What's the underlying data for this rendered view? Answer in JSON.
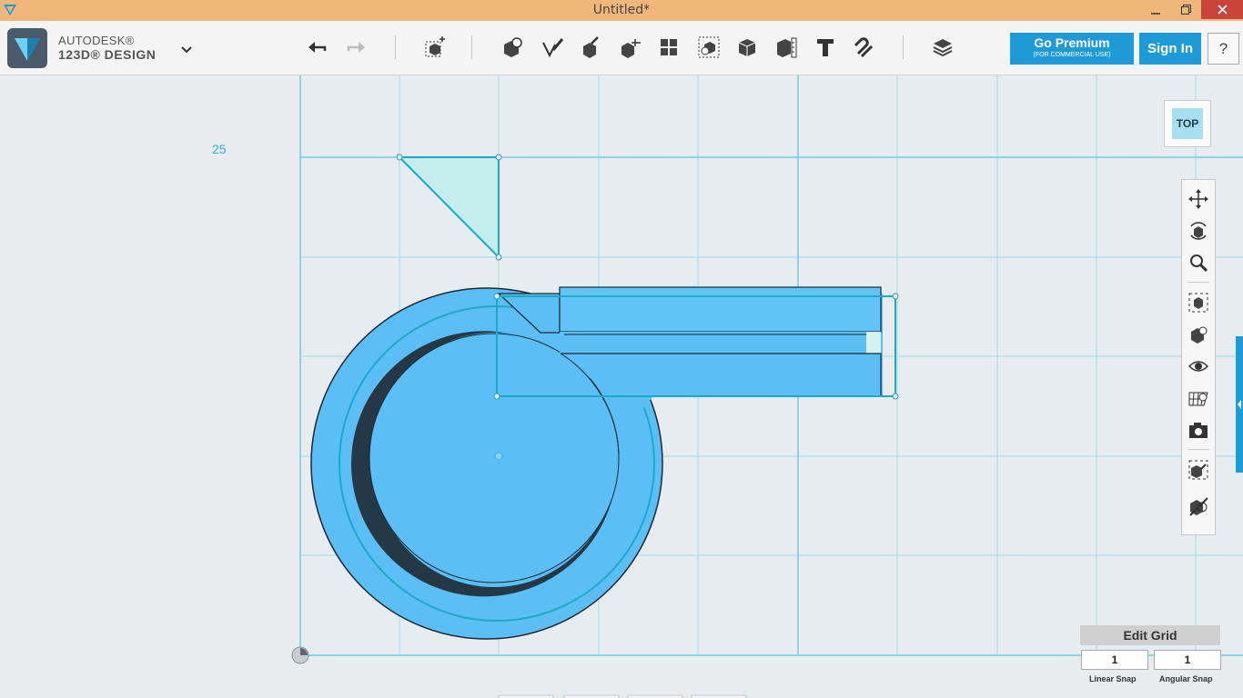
{
  "window": {
    "title": "Untitled*"
  },
  "brand": {
    "line1": "AUTODESK®",
    "line2": "123D® DESIGN"
  },
  "toolbar": {
    "tools": [
      "undo",
      "redo",
      "primitives",
      "sketch",
      "construct",
      "modify",
      "pattern",
      "grouping",
      "combine",
      "measure",
      "text",
      "snap",
      "materials"
    ]
  },
  "account": {
    "premium_title": "Go Premium",
    "premium_sub": "(FOR COMMERCIAL USE)",
    "signin_label": "Sign In",
    "help_label": "?"
  },
  "viewport": {
    "coordinate_label": "25",
    "view_cube_label": "TOP"
  },
  "navigation": {
    "items": [
      "pan",
      "orbit",
      "zoom",
      "fit",
      "view-mode",
      "visibility",
      "grid-material",
      "screenshot",
      "snap-settings",
      "hide-tool"
    ]
  },
  "grid": {
    "edit_label": "Edit Grid",
    "linear_snap_value": "1",
    "angular_snap_value": "1",
    "linear_snap_label": "Linear Snap",
    "angular_snap_label": "Angular Snap"
  },
  "colors": {
    "titlebar": "#f0b77a",
    "accent": "#1e9ad6",
    "model": "#5bbef5",
    "grid_line": "#7fd4e6"
  }
}
